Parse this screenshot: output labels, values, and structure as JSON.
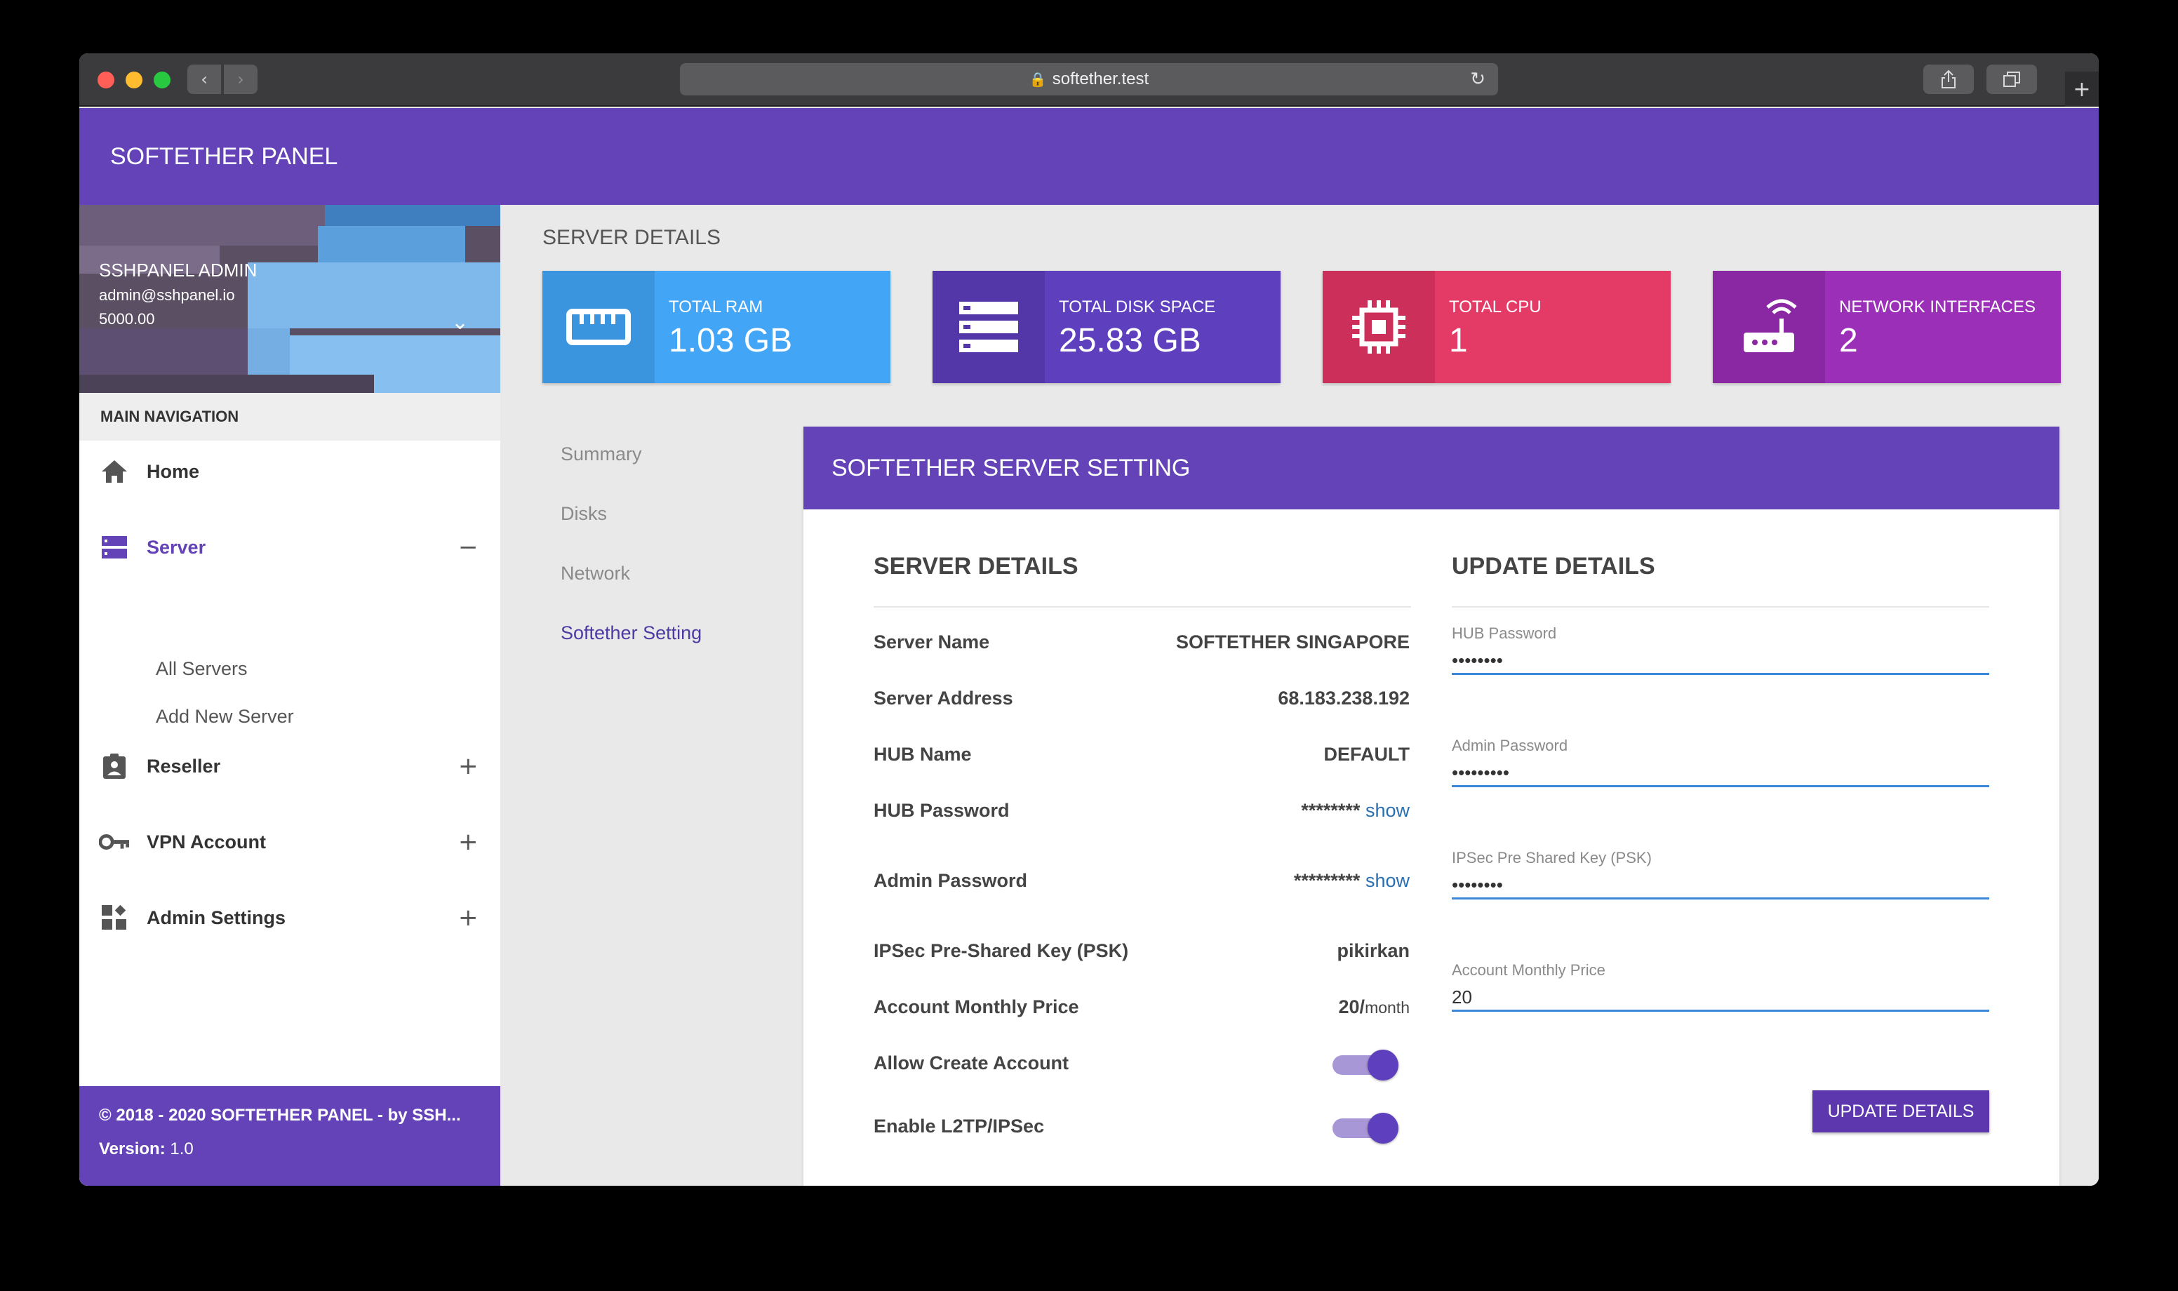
{
  "browser": {
    "url": "softether.test"
  },
  "app": {
    "title": "SOFTETHER PANEL"
  },
  "profile": {
    "name": "SSHPANEL ADMIN",
    "email": "admin@sshpanel.io",
    "balance": "5000.00"
  },
  "nav": {
    "header": "MAIN NAVIGATION",
    "home": "Home",
    "server": "Server",
    "server_toggle": "−",
    "server_sub": [
      "All Servers",
      "Add New Server"
    ],
    "reseller": "Reseller",
    "vpn": "VPN Account",
    "admin": "Admin Settings",
    "expand": "+"
  },
  "footer": {
    "copyright": "© 2018 - 2020 SOFTETHER PANEL - by SSH...",
    "version_label": "Version:",
    "version_value": "1.0"
  },
  "content": {
    "title": "SERVER DETAILS",
    "stats": [
      {
        "label": "TOTAL RAM",
        "value": "1.03 GB",
        "color": "#42a5f5",
        "icon_bg": "#3a94de"
      },
      {
        "label": "TOTAL DISK SPACE",
        "value": "25.83 GB",
        "color": "#5e3fbe",
        "icon_bg": "#5336a8"
      },
      {
        "label": "TOTAL CPU",
        "value": "1",
        "color": "#e43a66",
        "icon_bg": "#cc2f59"
      },
      {
        "label": "NETWORK INTERFACES",
        "value": "2",
        "color": "#9c2fb8",
        "icon_bg": "#8a27a3"
      }
    ],
    "tabs": [
      "Summary",
      "Disks",
      "Network",
      "Softether Setting"
    ]
  },
  "card": {
    "title": "SOFTETHER SERVER SETTING",
    "details_title": "SERVER DETAILS",
    "update_title": "UPDATE DETAILS",
    "rows": [
      {
        "label": "Server Name",
        "value": "SOFTETHER SINGAPORE"
      },
      {
        "label": "Server Address",
        "value": "68.183.238.192"
      },
      {
        "label": "HUB Name",
        "value": "DEFAULT"
      },
      {
        "label": "HUB Password",
        "value": "********",
        "link": "show"
      },
      {
        "label": "Admin Password",
        "value": "*********",
        "link": "show"
      },
      {
        "label": "IPSec Pre-Shared Key (PSK)",
        "value": "pikirkan"
      },
      {
        "label": "Account Monthly Price",
        "value": "20/",
        "unit": "month"
      },
      {
        "label": "Allow Create Account"
      },
      {
        "label": "Enable L2TP/IPSec"
      }
    ],
    "fields": [
      {
        "label": "HUB Password",
        "value": "••••••••"
      },
      {
        "label": "Admin Password",
        "value": "•••••••••"
      },
      {
        "label": "IPSec Pre Shared Key (PSK)",
        "value": "••••••••"
      },
      {
        "label": "Account Monthly Price",
        "value": "20"
      }
    ],
    "button": "UPDATE DETAILS"
  }
}
